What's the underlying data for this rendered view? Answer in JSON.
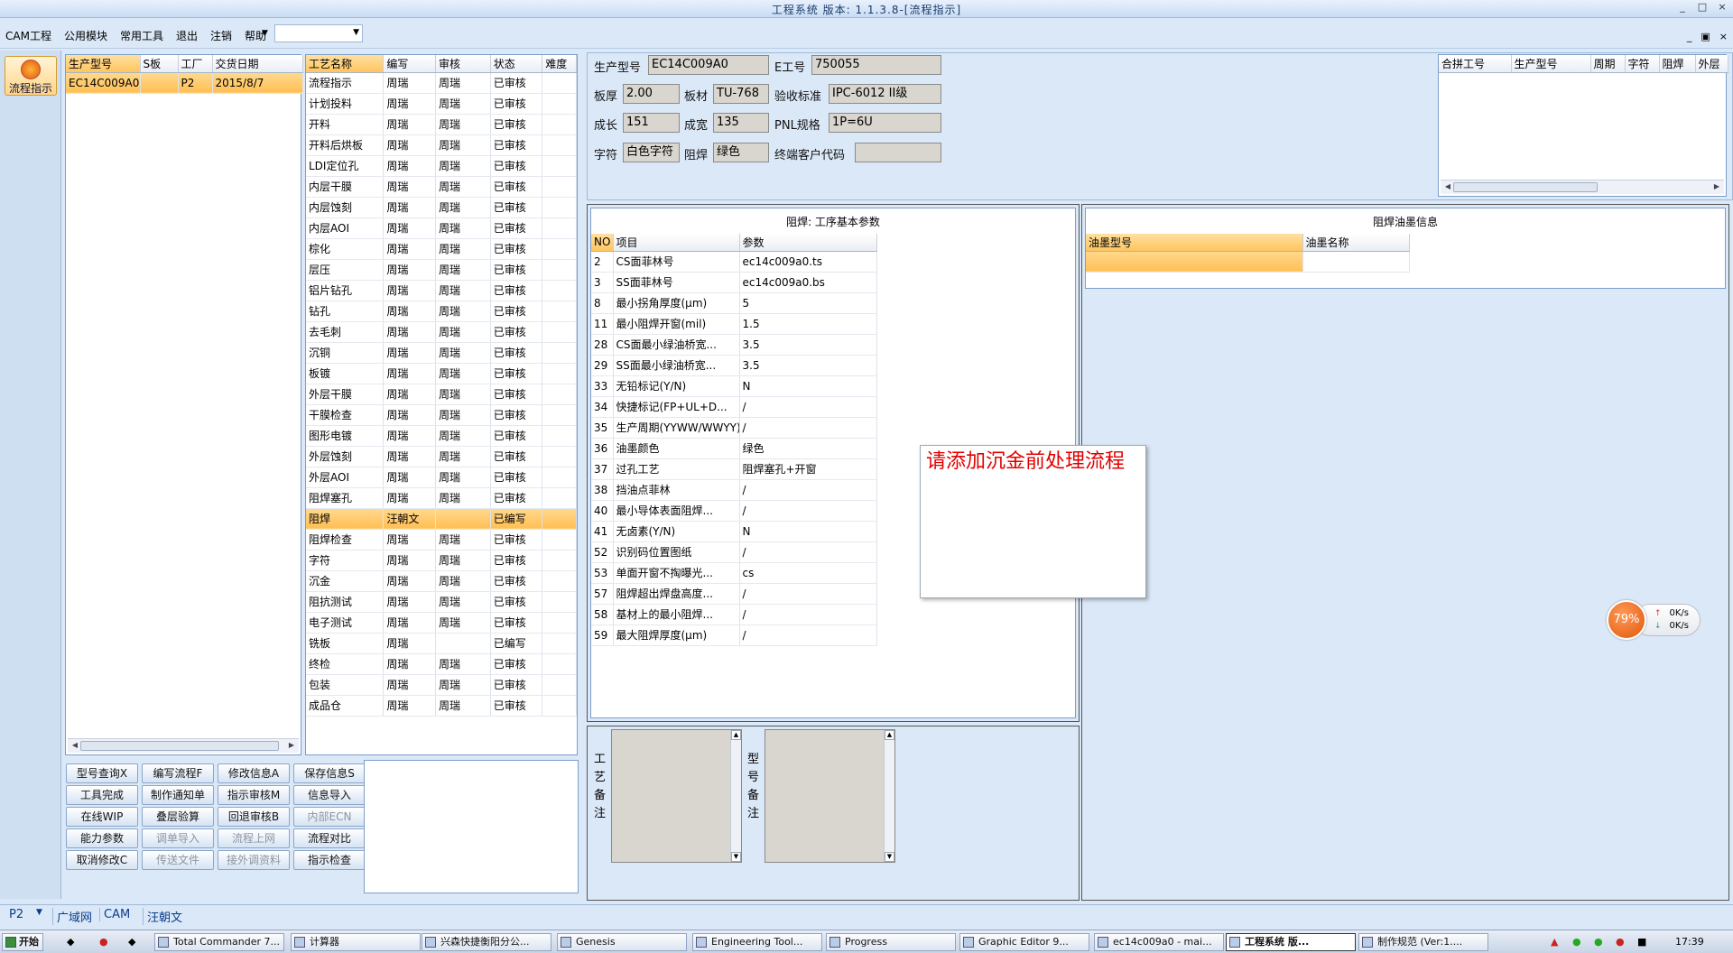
{
  "window": {
    "title": "工程系统 版本: 1.1.3.8-[流程指示]",
    "controls": [
      "_",
      "□",
      "×"
    ]
  },
  "menu": {
    "items": [
      "CAM工程",
      "公用模块",
      "常用工具",
      "退出",
      "注销",
      "帮助"
    ],
    "combo_value": "",
    "mdi_controls": [
      "_",
      "▣",
      "×"
    ]
  },
  "left_nav": {
    "flow_button": "流程指示"
  },
  "order_grid": {
    "columns": [
      "生产型号",
      "S板",
      "工厂",
      "交货日期"
    ],
    "rows": [
      [
        "EC14C009A0",
        "",
        "P2",
        "2015/8/7"
      ]
    ]
  },
  "process_grid": {
    "columns": [
      "工艺名称",
      "编写",
      "审核",
      "状态",
      "难度"
    ],
    "rows": [
      [
        "流程指示",
        "周瑞",
        "周瑞",
        "已审核",
        ""
      ],
      [
        "计划投料",
        "周瑞",
        "周瑞",
        "已审核",
        ""
      ],
      [
        "开料",
        "周瑞",
        "周瑞",
        "已审核",
        ""
      ],
      [
        "开料后烘板",
        "周瑞",
        "周瑞",
        "已审核",
        ""
      ],
      [
        "LDI定位孔",
        "周瑞",
        "周瑞",
        "已审核",
        ""
      ],
      [
        "内层干膜",
        "周瑞",
        "周瑞",
        "已审核",
        ""
      ],
      [
        "内层蚀刻",
        "周瑞",
        "周瑞",
        "已审核",
        ""
      ],
      [
        "内层AOI",
        "周瑞",
        "周瑞",
        "已审核",
        ""
      ],
      [
        "棕化",
        "周瑞",
        "周瑞",
        "已审核",
        ""
      ],
      [
        "层压",
        "周瑞",
        "周瑞",
        "已审核",
        ""
      ],
      [
        "铝片钻孔",
        "周瑞",
        "周瑞",
        "已审核",
        ""
      ],
      [
        "钻孔",
        "周瑞",
        "周瑞",
        "已审核",
        ""
      ],
      [
        "去毛刺",
        "周瑞",
        "周瑞",
        "已审核",
        ""
      ],
      [
        "沉铜",
        "周瑞",
        "周瑞",
        "已审核",
        ""
      ],
      [
        "板镀",
        "周瑞",
        "周瑞",
        "已审核",
        ""
      ],
      [
        "外层干膜",
        "周瑞",
        "周瑞",
        "已审核",
        ""
      ],
      [
        "干膜检查",
        "周瑞",
        "周瑞",
        "已审核",
        ""
      ],
      [
        "图形电镀",
        "周瑞",
        "周瑞",
        "已审核",
        ""
      ],
      [
        "外层蚀刻",
        "周瑞",
        "周瑞",
        "已审核",
        ""
      ],
      [
        "外层AOI",
        "周瑞",
        "周瑞",
        "已审核",
        ""
      ],
      [
        "阻焊塞孔",
        "周瑞",
        "周瑞",
        "已审核",
        ""
      ],
      [
        "阻焊",
        "汪朝文",
        "",
        "已编写",
        ""
      ],
      [
        "阻焊检查",
        "周瑞",
        "周瑞",
        "已审核",
        ""
      ],
      [
        "字符",
        "周瑞",
        "周瑞",
        "已审核",
        ""
      ],
      [
        "沉金",
        "周瑞",
        "周瑞",
        "已审核",
        ""
      ],
      [
        "阻抗测试",
        "周瑞",
        "周瑞",
        "已审核",
        ""
      ],
      [
        "电子测试",
        "周瑞",
        "周瑞",
        "已审核",
        ""
      ],
      [
        "铣板",
        "周瑞",
        "",
        "已编写",
        ""
      ],
      [
        "终检",
        "周瑞",
        "周瑞",
        "已审核",
        ""
      ],
      [
        "包装",
        "周瑞",
        "周瑞",
        "已审核",
        ""
      ],
      [
        "成品仓",
        "周瑞",
        "周瑞",
        "已审核",
        ""
      ]
    ],
    "selected_index": 21
  },
  "buttons": [
    [
      "型号查询X",
      "编写流程F",
      "修改信息A",
      "保存信息S"
    ],
    [
      "工具完成",
      "制作通知单",
      "指示审核M",
      "信息导入"
    ],
    [
      "在线WIP",
      "叠层验算",
      "回退审核B",
      "内部ECN"
    ],
    [
      "能力参数",
      "调单导入",
      "流程上网",
      "流程对比"
    ],
    [
      "取消修改C",
      "传送文件",
      "接外调资料",
      "指示检查"
    ]
  ],
  "disabled_buttons": [
    "内部ECN",
    "调单导入",
    "流程上网",
    "传送文件",
    "接外调资料"
  ],
  "info": {
    "prod_model_label": "生产型号",
    "prod_model": "EC14C009A0",
    "e_no_label": "E工号",
    "e_no": "750055",
    "thickness_label": "板厚",
    "thickness": "2.00",
    "material_label": "板材",
    "material": "TU-768",
    "accept_label": "验收标准",
    "accept": "IPC-6012 II级",
    "length_label": "成长",
    "length": "151",
    "width_label": "成宽",
    "width": "135",
    "pnl_label": "PNL规格",
    "pnl": "1P=6U",
    "char_label": "字符",
    "char": "白色字符",
    "mask_label": "阻焊",
    "mask": "绿色",
    "cust_label": "终端客户代码",
    "cust": ""
  },
  "merge_grid": {
    "columns": [
      "合拼工号",
      "生产型号",
      "周期",
      "字符",
      "阻焊",
      "外层"
    ]
  },
  "params": {
    "title": "阻焊: 工序基本参数",
    "columns": [
      "NO",
      "项目",
      "参数"
    ],
    "rows": [
      [
        "2",
        "CS面菲林号",
        "ec14c009a0.ts"
      ],
      [
        "3",
        "SS面菲林号",
        "ec14c009a0.bs"
      ],
      [
        "8",
        "最小拐角厚度(μm)",
        "5"
      ],
      [
        "11",
        "最小阻焊开窗(mil)",
        "1.5"
      ],
      [
        "28",
        "CS面最小绿油桥宽...",
        "3.5"
      ],
      [
        "29",
        "SS面最小绿油桥宽...",
        "3.5"
      ],
      [
        "33",
        "无铅标记(Y/N)",
        "N"
      ],
      [
        "34",
        "快捷标记(FP+UL+D...",
        "/"
      ],
      [
        "35",
        "生产周期(YYWW/WWYY)",
        "/"
      ],
      [
        "36",
        "油墨颜色",
        "绿色"
      ],
      [
        "37",
        "过孔工艺",
        "阻焊塞孔+开窗"
      ],
      [
        "38",
        "挡油点菲林",
        "/"
      ],
      [
        "40",
        "最小导体表面阻焊...",
        "/"
      ],
      [
        "41",
        "无卤素(Y/N)",
        "N"
      ],
      [
        "52",
        "识别码位置图纸",
        "/"
      ],
      [
        "53",
        "单面开窗不掏曝光...",
        "cs"
      ],
      [
        "57",
        "阻焊超出焊盘高度...",
        "/"
      ],
      [
        "58",
        "基材上的最小阻焊...",
        "/"
      ],
      [
        "59",
        "最大阻焊厚度(μm)",
        "/"
      ]
    ]
  },
  "ink": {
    "title": "阻焊油墨信息",
    "columns": [
      "油墨型号",
      "油墨名称"
    ]
  },
  "remarks": {
    "process_label": "工艺备注",
    "model_label": "型号备注"
  },
  "popup": {
    "message": "请添加沉金前处理流程"
  },
  "netmon": {
    "percent": "79%",
    "up": "0K/s",
    "down": "0K/s"
  },
  "status": {
    "factory": "P2",
    "tabs": [
      "广域网",
      "CAM",
      "汪朝文"
    ]
  },
  "taskbar": {
    "start": "开始",
    "tasks": [
      "Total Commander 7...",
      "计算器",
      "兴森快捷衡阳分公...",
      "Genesis",
      "Engineering Tool...",
      "Progress",
      "Graphic Editor 9...",
      "ec14c009a0 - mai...",
      "工程系统 版...",
      "制作规范 (Ver:1...."
    ],
    "active_index": 8,
    "clock": "17:39"
  },
  "colors": {
    "selection": "#ffbf54",
    "popup_text": "#e00000",
    "window_bg": "#dbe8f7"
  }
}
